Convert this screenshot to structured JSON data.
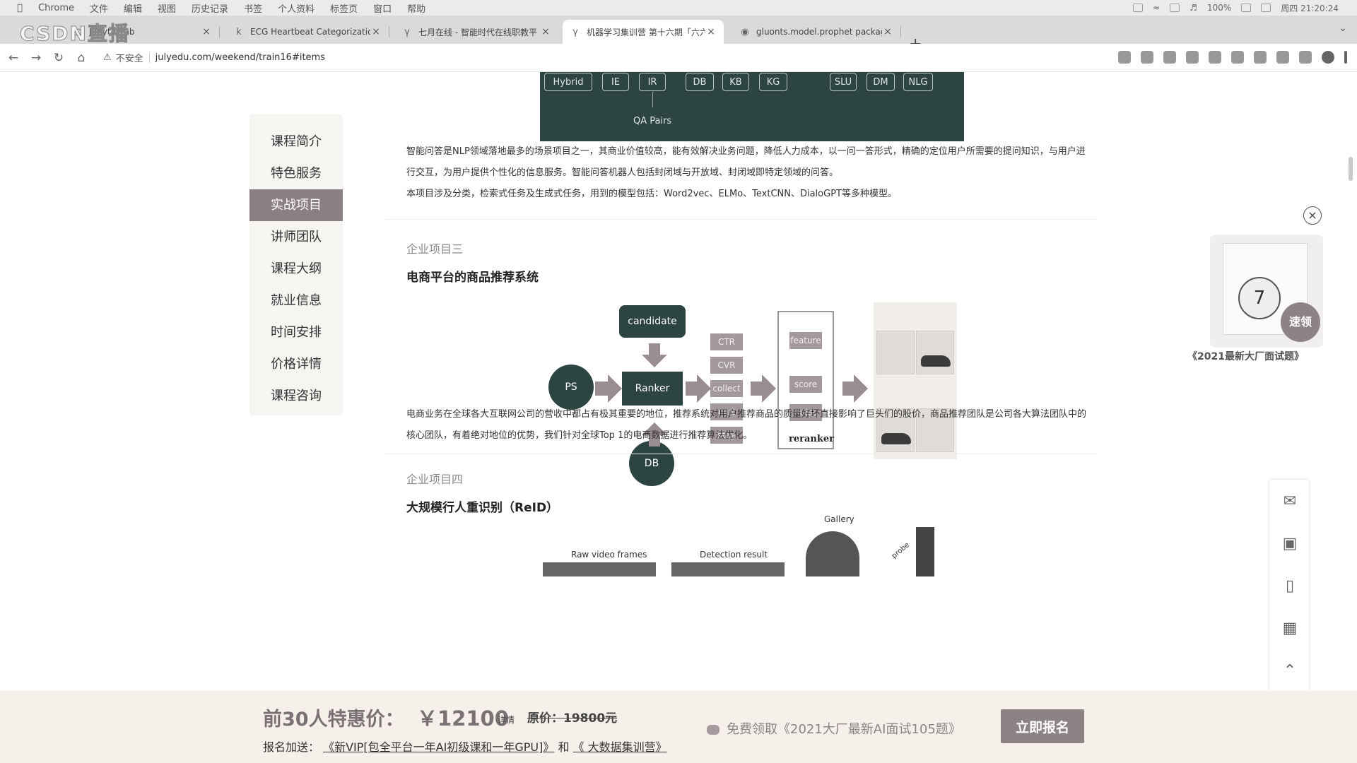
{
  "menubar": {
    "app": "Chrome",
    "items": [
      "文件",
      "编辑",
      "视图",
      "历史记录",
      "书签",
      "个人资料",
      "标签页",
      "窗口",
      "帮助"
    ],
    "battery": "100%",
    "clock": "周四 21:20:24"
  },
  "tabs": [
    {
      "icon": "jupyter",
      "title": "JupyterLab"
    },
    {
      "icon": "k",
      "title": "ECG Heartbeat Categorization"
    },
    {
      "icon": "julyedu",
      "title": "七月在线 - 智能时代在线职教平"
    },
    {
      "icon": "julyedu",
      "title": "机器学习集训营 第十六期「六六"
    },
    {
      "icon": "globe",
      "title": "gluonts.model.prophet packag"
    }
  ],
  "toolbar": {
    "security": "不安全",
    "url": "julyedu.com/weekend/train16#items"
  },
  "sidenav": [
    "课程简介",
    "特色服务",
    "实战项目",
    "讲师团队",
    "课程大纲",
    "就业信息",
    "时间安排",
    "价格详情",
    "课程咨询"
  ],
  "top_diagram": {
    "boxes": [
      "Hybrid",
      "IE",
      "IR",
      "DB",
      "KB",
      "KG",
      "SLU",
      "DM",
      "NLG"
    ],
    "qa_label": "QA Pairs"
  },
  "project2_text": {
    "p1": "智能问答是NLP领域落地最多的场景项目之一，其商业价值较高，能有效解决业务问题，降低人力成本，以一问一答形式，精确的定位用户所需要的提问知识，与用户进行交互，为用户提供个性化的信息服务。智能问答机器人包括封闭域与开放域、封闭域即特定领域的问答。",
    "p2": "本项目涉及分类，检索式任务及生成式任务，用到的模型包括：Word2vec、ELMo、TextCNN、DialoGPT等多种模型。"
  },
  "project3": {
    "label": "企业项目三",
    "title": "电商平台的商品推荐系统",
    "diagram": {
      "candidate": "candidate",
      "ps": "PS",
      "ranker": "Ranker",
      "db": "DB",
      "features": [
        "CTR",
        "CVR",
        "collect",
        "cart",
        "stay"
      ],
      "reranker_items": [
        "feature",
        "score",
        "Rules"
      ],
      "reranker_label": "reranker"
    },
    "text": "电商业务在全球各大互联网公司的营收中都占有极其重要的地位，推荐系统对用户推荐商品的质量好坏直接影响了巨头们的股价，商品推荐团队是公司各大算法团队中的核心团队，有着绝对地位的优势，我们针对全球Top 1的电商数据进行推荐算法优化。"
  },
  "project4": {
    "label": "企业项目四",
    "title": "大规模行人重识别（ReID）",
    "diagram": {
      "gallery": "Gallery",
      "raw": "Raw video frames",
      "detection": "Detection result",
      "probe": "probe"
    }
  },
  "float_promo": {
    "quick": "速领",
    "caption": "《2021最新大厂面试题》"
  },
  "bottom_bar": {
    "price_label": "前30人特惠价：",
    "price": "￥12100",
    "detail": "详情",
    "orig_label": "原价：",
    "orig_price": "19800元",
    "gift_prefix": "报名加送：",
    "gift_link1": "《新VIP[包全平台一年AI初级课和一年GPU]》",
    "gift_and": "和",
    "gift_link2": "《 大数据集训营》",
    "free_offer": "免费领取《2021大厂最新AI面试105题》",
    "signup": "立即报名"
  }
}
